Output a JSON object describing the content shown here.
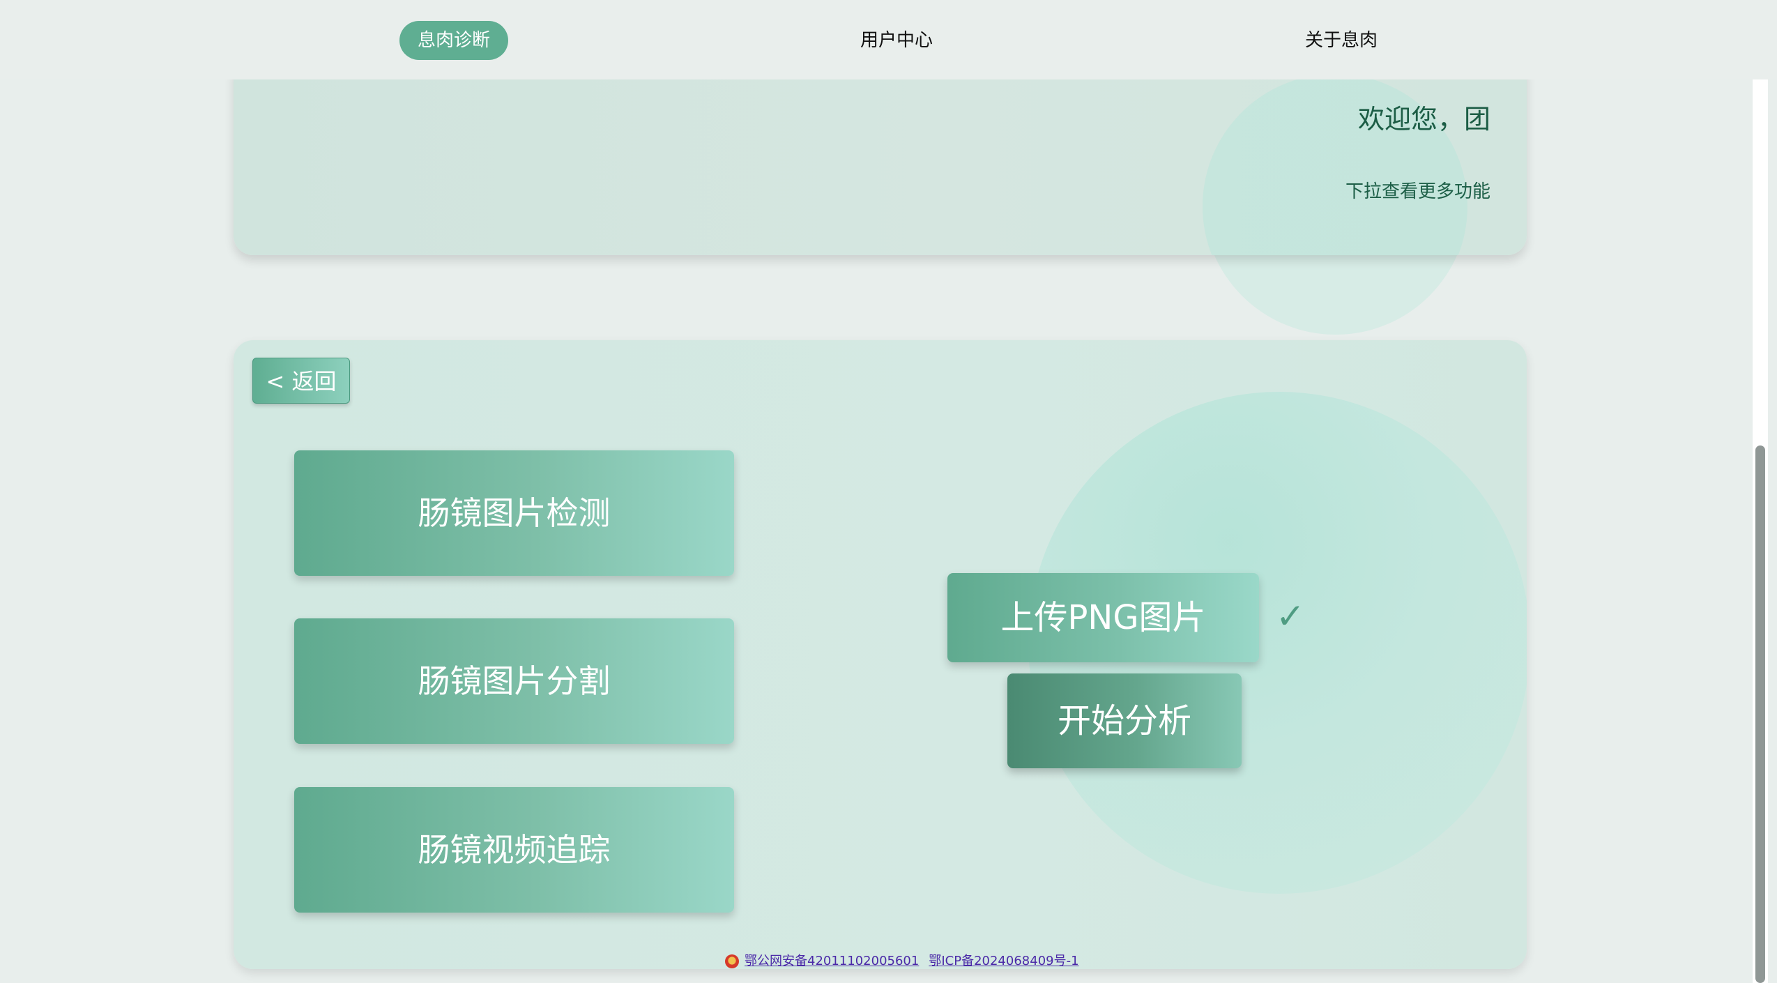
{
  "nav": {
    "items": [
      {
        "label": "息肉诊断",
        "active": true
      },
      {
        "label": "用户中心",
        "active": false
      },
      {
        "label": "关于息肉",
        "active": false
      }
    ]
  },
  "welcome": {
    "title": "欢迎您，团",
    "subtitle": "下拉查看更多功能"
  },
  "main": {
    "back_label": "< 返回",
    "menu": [
      {
        "label": "肠镜图片检测"
      },
      {
        "label": "肠镜图片分割"
      },
      {
        "label": "肠镜视频追踪"
      }
    ],
    "upload_label": "上传PNG图片",
    "check_icon": "check-icon",
    "analyze_label": "开始分析"
  },
  "footer": {
    "badge_icon": "police-badge-icon",
    "links": [
      {
        "text": "鄂公网安备42011102005601"
      },
      {
        "text": "鄂ICP备2024068409号-1"
      }
    ]
  },
  "colors": {
    "accent": "#5fae92",
    "text_dark_green": "#1c5d45",
    "link": "#4b2aa8"
  }
}
